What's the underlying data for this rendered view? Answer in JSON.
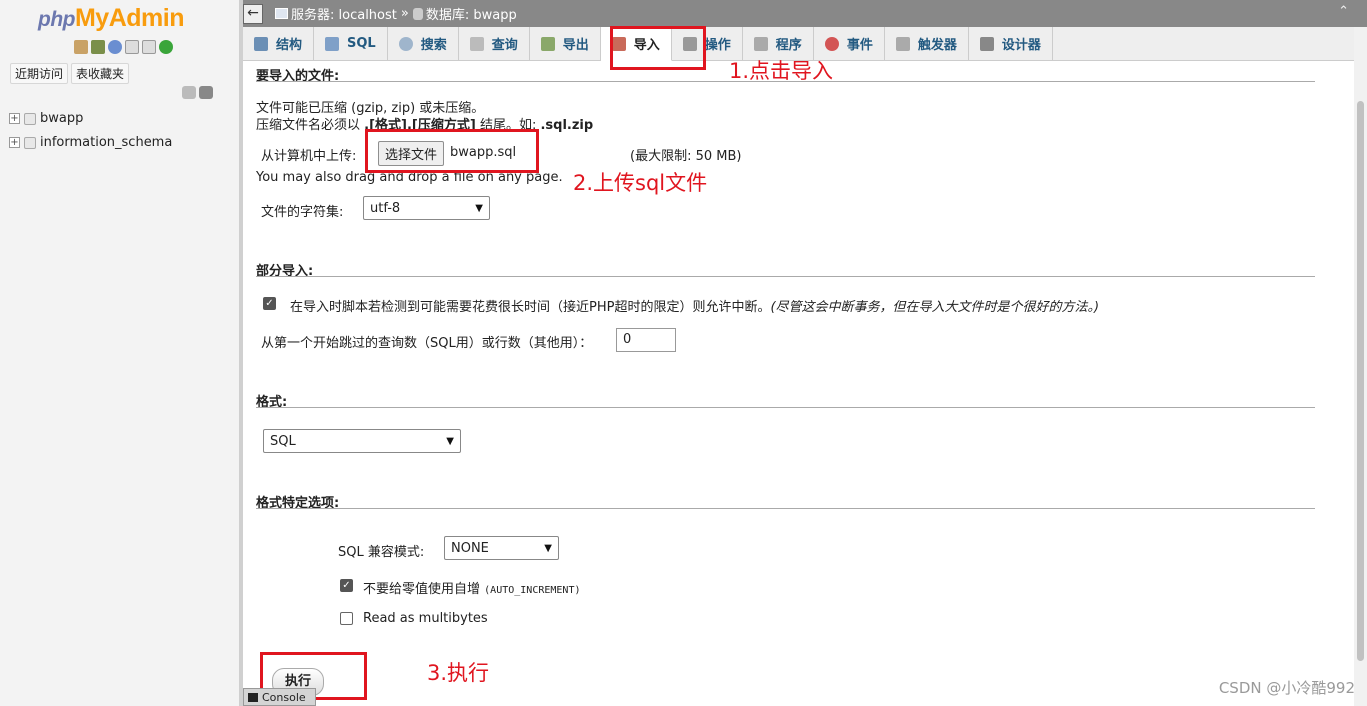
{
  "sidebar": {
    "logo": {
      "php": "php",
      "my": "My",
      "admin": "Admin"
    },
    "buttons": [
      "近期访问",
      "表收藏夹"
    ],
    "databases": [
      {
        "name": "bwapp"
      },
      {
        "name": "information_schema"
      }
    ]
  },
  "breadcrumb": {
    "back": "←",
    "server": "服务器: localhost",
    "separator": "»",
    "database": "数据库: bwapp",
    "minimize": "⌃"
  },
  "tabs": [
    {
      "label": "结构",
      "icon": "structure-icon"
    },
    {
      "label": "SQL",
      "icon": "sql-icon"
    },
    {
      "label": "搜索",
      "icon": "search-icon"
    },
    {
      "label": "查询",
      "icon": "query-icon"
    },
    {
      "label": "导出",
      "icon": "export-icon"
    },
    {
      "label": "导入",
      "icon": "import-icon",
      "active": true
    },
    {
      "label": "操作",
      "icon": "operations-icon"
    },
    {
      "label": "程序",
      "icon": "routines-icon"
    },
    {
      "label": "事件",
      "icon": "events-icon"
    },
    {
      "label": "触发器",
      "icon": "triggers-icon"
    },
    {
      "label": "设计器",
      "icon": "designer-icon"
    }
  ],
  "import": {
    "file_section": {
      "legend": "要导入的文件:",
      "line1": "文件可能已压缩 (gzip, zip) 或未压缩。",
      "line2_prefix": "压缩文件名必须以",
      "line2_bold": ".[格式].[压缩方式]",
      "line2_mid": "结尾。如:",
      "line2_example": ".sql.zip",
      "upload_label": "从计算机中上传:",
      "choose_button": "选择文件",
      "chosen_file": "bwapp.sql",
      "max_limit": "(最大限制: 50 MB)",
      "drag_hint": "You may also drag and drop a file on any page.",
      "charset_label": "文件的字符集:",
      "charset_value": "utf-8"
    },
    "partial_section": {
      "legend": "部分导入:",
      "allow_interrupt_label": "在导入时脚本若检测到可能需要花费很长时间（接近PHP超时的限定）则允许中断。",
      "allow_interrupt_hint": "(尽管这会中断事务，但在导入大文件时是个很好的方法。)",
      "allow_interrupt_checked": true,
      "skip_label": "从第一个开始跳过的查询数（SQL用）或行数（其他用）：",
      "skip_value": "0"
    },
    "format_section": {
      "legend": "格式:",
      "format_value": "SQL"
    },
    "format_options": {
      "legend": "格式特定选项:",
      "compat_label": "SQL 兼容模式:",
      "compat_value": "NONE",
      "no_auto_value_label": "不要给零值使用自增",
      "no_auto_value_code": "(AUTO_INCREMENT)",
      "no_auto_value_checked": true,
      "multibytes_label": "Read as multibytes",
      "multibytes_checked": false
    },
    "go_button": "执行"
  },
  "annotations": {
    "step1": "1.点击导入",
    "step2": "2.上传sql文件",
    "step3": "3.执行",
    "color": "#e0151f"
  },
  "console": {
    "label": "Console"
  },
  "watermark": "CSDN @小冷酷992",
  "colors": {
    "tab_text": "#235a81",
    "logo_php": "#6c78af",
    "logo_myadmin": "#f89c0e"
  }
}
